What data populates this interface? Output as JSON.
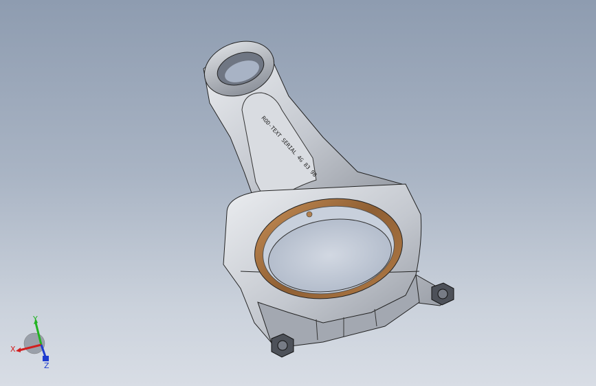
{
  "viewport": {
    "background_top": "#8e9cb0",
    "background_bottom": "#d8dde5"
  },
  "part": {
    "name_icon": "connecting-rod-model",
    "engraving": "ROD-TEXT SERIAL 4G 83 98",
    "bearing_color": "#9a6a3c",
    "body_color": "#c9cdd4"
  },
  "triad": {
    "x_label": "X",
    "y_label": "Y",
    "z_label": "Z",
    "x_color": "#d21e1e",
    "y_color": "#22b322",
    "z_color": "#1e3ccf"
  }
}
